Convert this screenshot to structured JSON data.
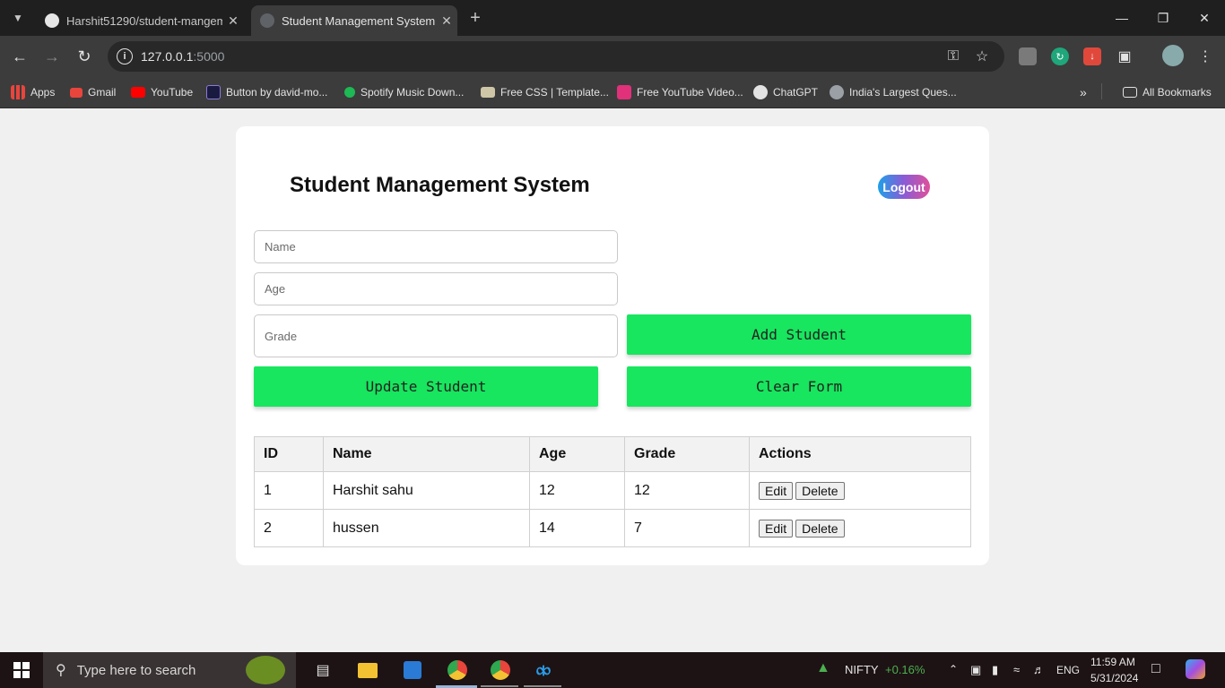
{
  "browser": {
    "tabs": [
      {
        "title": "Harshit51290/student-mangem",
        "active": false
      },
      {
        "title": "Student Management System",
        "active": true
      }
    ],
    "url_host": "127.0.0.1",
    "url_port": ":5000",
    "bookmarks": [
      "Apps",
      "Gmail",
      "YouTube",
      "Button by david-mo...",
      "Spotify Music Down...",
      "Free CSS | Template...",
      "Free YouTube Video...",
      "ChatGPT",
      "India's Largest Ques..."
    ],
    "all_bookmarks": "All Bookmarks"
  },
  "app": {
    "title": "Student Management System",
    "logout_label": "Logout",
    "form": {
      "name_placeholder": "Name",
      "age_placeholder": "Age",
      "grade_placeholder": "Grade",
      "add_label": "Add Student",
      "update_label": "Update Student",
      "clear_label": "Clear Form"
    },
    "table": {
      "headers": [
        "ID",
        "Name",
        "Age",
        "Grade",
        "Actions"
      ],
      "rows": [
        {
          "id": "1",
          "name": "Harshit sahu",
          "age": "12",
          "grade": "12"
        },
        {
          "id": "2",
          "name": "hussen",
          "age": "14",
          "grade": "7"
        }
      ],
      "edit_label": "Edit",
      "delete_label": "Delete"
    },
    "colors": {
      "accent_green": "#17e65e"
    }
  },
  "taskbar": {
    "search_placeholder": "Type here to search",
    "nifty_label": "NIFTY",
    "nifty_change": "+0.16%",
    "language": "ENG",
    "time": "11:59 AM",
    "date": "5/31/2024"
  }
}
